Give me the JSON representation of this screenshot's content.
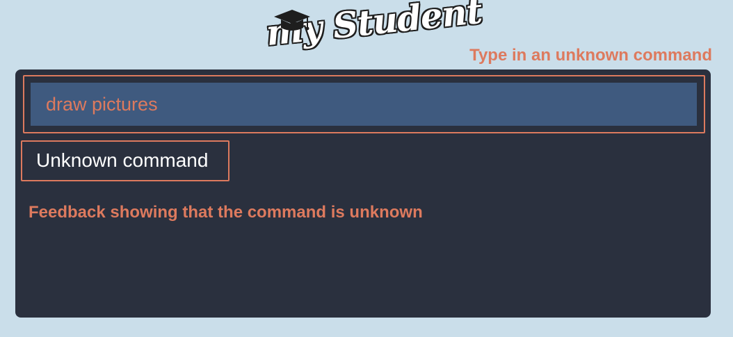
{
  "app": {
    "logo_text": "my Student",
    "logo_icon": "graduation-cap-icon"
  },
  "annotations": {
    "input_note": "Type in an unknown command",
    "result_note": "Feedback showing that the command is unknown"
  },
  "command_box": {
    "value": "draw pictures"
  },
  "result_display": {
    "text": "Unknown command"
  },
  "colors": {
    "background": "#cadeea",
    "panel": "#2a303e",
    "input_background": "#3f5a7f",
    "accent": "#dd7a5e",
    "text_light": "#ffffff"
  }
}
